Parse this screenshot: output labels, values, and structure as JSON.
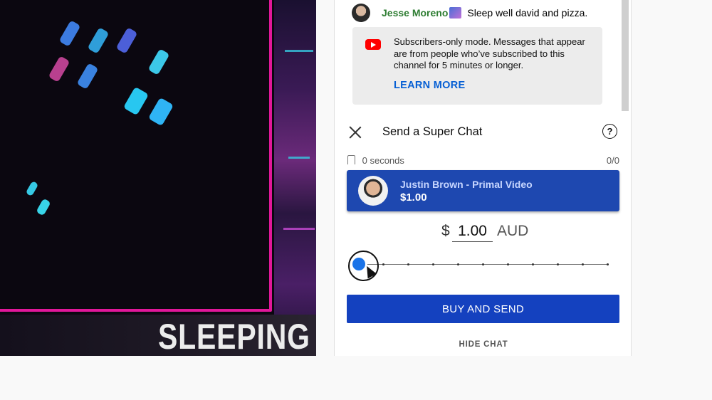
{
  "video": {
    "overlay_text": "SLEEPING"
  },
  "chat": {
    "message": {
      "author": "Jesse Moreno",
      "text": "Sleep well david and pizza."
    },
    "notice": {
      "text": "Subscribers-only mode. Messages that appear are from people who’ve subscribed to this channel for 5 minutes or longer.",
      "link": "LEARN MORE"
    },
    "superchat": {
      "title": "Send a Super Chat",
      "help": "?",
      "pin_duration": "0 seconds",
      "char_count": "0/0",
      "card_name": "Justin Brown - Primal Video",
      "card_amount": "$1.00",
      "currency_symbol": "$",
      "amount": "1.00",
      "currency": "AUD",
      "slider_level_fraction": 0,
      "buy_label": "BUY AND SEND"
    },
    "hide_label": "HIDE CHAT"
  },
  "colors": {
    "accent_blue": "#1441bf",
    "card_blue": "#1e48b0",
    "knob_blue": "#1a73e8",
    "frame_pink": "#e1179a"
  }
}
